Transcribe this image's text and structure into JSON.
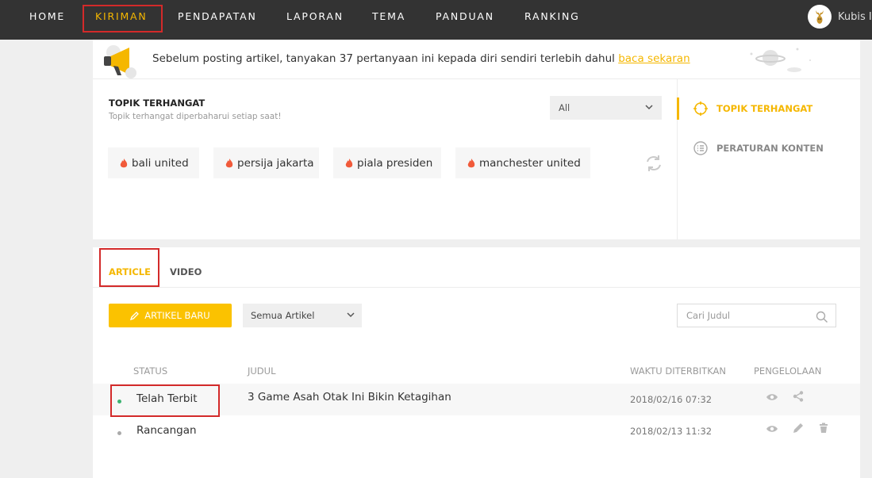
{
  "nav": {
    "items": [
      {
        "label": "HOME",
        "active": false
      },
      {
        "label": "KIRIMAN",
        "active": true
      },
      {
        "label": "PENDAPATAN",
        "active": false
      },
      {
        "label": "LAPORAN",
        "active": false
      },
      {
        "label": "TEMA",
        "active": false
      },
      {
        "label": "PANDUAN",
        "active": false
      },
      {
        "label": "RANKING",
        "active": false
      }
    ],
    "user_name": "Kubis I",
    "avatar_icon": "deer-logo-icon"
  },
  "notice": {
    "text": "Sebelum posting artikel, tanyakan 37 pertanyaan ini kepada diri sendiri terlebih dahul",
    "link": "baca sekaran",
    "icon": "megaphone-icon"
  },
  "trending": {
    "title": "TOPIK TERHANGAT",
    "subtitle": "Topik terhangat diperbaharui setiap saat!",
    "filter_value": "All",
    "chips": [
      "bali united",
      "persija jakarta",
      "piala presiden",
      "manchester united"
    ],
    "chip_icon": "flame-icon",
    "refresh_icon": "refresh-icon"
  },
  "sidebar": {
    "items": [
      {
        "label": "TOPIK TERHANGAT",
        "icon": "target-icon",
        "active": true
      },
      {
        "label": "PERATURAN KONTEN",
        "icon": "list-icon",
        "active": false
      }
    ]
  },
  "articles": {
    "tabs": [
      {
        "label": "ARTICLE",
        "active": true
      },
      {
        "label": "VIDEO",
        "active": false
      }
    ],
    "new_button": "ARTIKEL BARU",
    "filter_value": "Semua Artikel",
    "search_placeholder": "Cari Judul",
    "columns": [
      "STATUS",
      "JUDUL",
      "WAKTU DITERBITKAN",
      "PENGELOLAAN"
    ],
    "rows": [
      {
        "status": "Telah Terbit",
        "status_color": "#3cb371",
        "title": "3 Game Asah Otak Ini Bikin Ketagihan",
        "time": "2018/02/16 07:32",
        "actions": [
          "eye-icon",
          "share-icon"
        ]
      },
      {
        "status": "Rancangan",
        "status_color": "#aaaaaa",
        "title": "",
        "time": "2018/02/13 11:32",
        "actions": [
          "eye-icon",
          "pencil-icon",
          "trash-icon"
        ]
      }
    ]
  },
  "colors": {
    "accent": "#f5b700",
    "nav_bg": "#333333",
    "highlight_border": "#d32a2a"
  }
}
